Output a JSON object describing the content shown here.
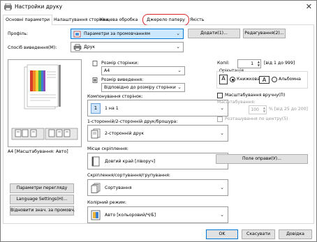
{
  "window": {
    "title": "Настройки друку",
    "close": "✕"
  },
  "tabs": [
    "Основні параметри",
    "Налаштування сторінки",
    "Кінцева обробка",
    "Джерело паперу",
    "Якість"
  ],
  "profile": {
    "label": "Профіль:",
    "value": "Параметри за промовчанням",
    "add": "Додати(1)...",
    "edit": "Редагування(2)..."
  },
  "output": {
    "label": "Спосіб виведення(M):",
    "value": "Друк"
  },
  "page_size": {
    "label": "Розмір сторінки:",
    "value": "A4"
  },
  "output_size": {
    "label": "Розмір виведення:",
    "value": "Відповідно до розміру сторінки"
  },
  "copies": {
    "label": "Копії:",
    "value": "1",
    "range": "[від 1 до 999]"
  },
  "orientation": {
    "label": "Орієнтація",
    "portrait": "Книжкова",
    "landscape": "Альбомна",
    "portrait_glyph": "A",
    "landscape_glyph": "A"
  },
  "layout": {
    "label": "Компонування сторінок:",
    "value": "1 на 1",
    "icon_glyph": "1"
  },
  "manual_scale": {
    "label": "Масштабування вручну(П)",
    "sub": "Масштабування:",
    "value": "100",
    "range": "% [від 25 до 200]"
  },
  "center": {
    "label": "Розташування по центру(5)"
  },
  "duplex": {
    "label": "1-сторонній/2-сторонній друк/брошура:",
    "value": "2-сторонній друк"
  },
  "binding": {
    "label": "Місце скріплення:",
    "value": "Довгий край [ліворуч]",
    "gutter": "Поле оправи(У)..."
  },
  "finishing": {
    "label": "Скріплення/сортування/групування:",
    "value": "Сортування"
  },
  "color": {
    "label": "Колірний режим:",
    "value": "Авто [кольоровий/Ч/Б]"
  },
  "preview": {
    "caption": "A4 [Масштабування: Авто]"
  },
  "left_buttons": [
    "Параметри перегляду",
    "Language Settings(H)...",
    "Відновити знач. за промовч."
  ],
  "footer": {
    "ok": "OK",
    "cancel": "Скасувати",
    "help": "Довідка"
  },
  "colors": {
    "highlight": "#d9262b",
    "selected": "#cce8ff",
    "accent": "#0078d7"
  }
}
